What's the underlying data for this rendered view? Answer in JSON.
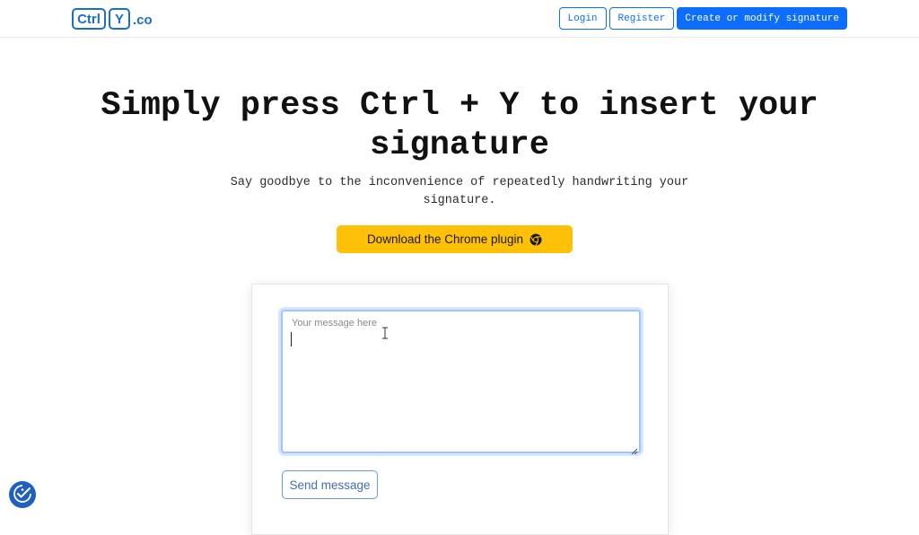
{
  "navbar": {
    "logo": {
      "key1": "Ctrl",
      "key2": "Y",
      "suffix": ".co"
    },
    "login_label": "Login",
    "register_label": "Register",
    "create_label": "Create or modify signature"
  },
  "hero": {
    "title": "Simply press Ctrl + Y to insert your signature",
    "subtitle": "Say goodbye to the inconvenience of repeatedly handwriting your signature.",
    "download_label": "Download the Chrome plugin",
    "download_icon": "chrome-icon"
  },
  "form": {
    "message_placeholder": "Your message here",
    "message_value": "",
    "send_label": "Send message"
  },
  "accessibility": {
    "icon": "accessibility-check-icon"
  },
  "colors": {
    "brand": "#1a6fc9",
    "primary": "#0d6efd",
    "warning": "#ffc107"
  }
}
